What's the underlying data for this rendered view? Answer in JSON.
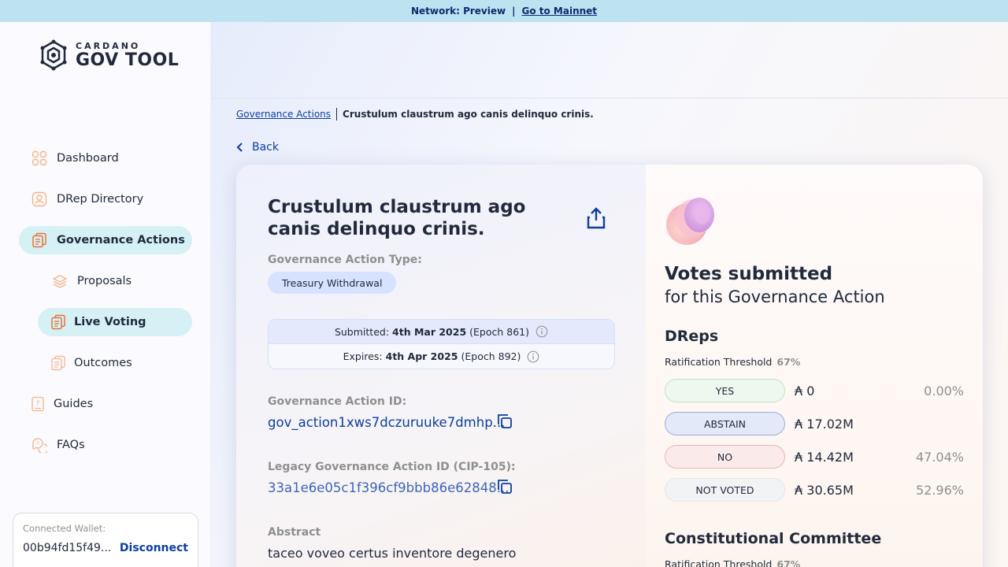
{
  "topbar": {
    "network": "Network: Preview",
    "separator": "|",
    "mainnet_link": "Go to Mainnet"
  },
  "logo": {
    "small": "CARDANO",
    "big": "GOV TOOL"
  },
  "sidebar": {
    "items": [
      {
        "label": "Dashboard",
        "icon": "dashboard-icon"
      },
      {
        "label": "DRep Directory",
        "icon": "drep-directory-icon"
      },
      {
        "label": "Governance Actions",
        "icon": "governance-actions-icon",
        "active": true
      },
      {
        "label": "Proposals",
        "icon": "proposals-icon"
      },
      {
        "label": "Live Voting",
        "icon": "live-voting-icon",
        "active": true
      },
      {
        "label": "Outcomes",
        "icon": "outcomes-icon"
      },
      {
        "label": "Guides",
        "icon": "guides-icon"
      },
      {
        "label": "FAQs",
        "icon": "faqs-icon"
      }
    ]
  },
  "wallet": {
    "label": "Connected Wallet:",
    "address": "00b94fd15f49...",
    "disconnect": "Disconnect"
  },
  "breadcrumb": {
    "parent": "Governance Actions",
    "current": "Crustulum claustrum ago canis delinquo crinis."
  },
  "back_label": "Back",
  "action": {
    "title": "Crustulum claustrum ago canis delinquo crinis.",
    "type_label": "Governance Action Type:",
    "type_value": "Treasury Withdrawal",
    "submitted_label": "Submitted:",
    "submitted_date": "4th Mar 2025",
    "submitted_epoch": "(Epoch 861)",
    "expires_label": "Expires:",
    "expires_date": "4th Apr 2025",
    "expires_epoch": "(Epoch 892)",
    "id_label": "Governance Action ID:",
    "id_value": "gov_action1xws7dczuruuke7dmhp...",
    "legacy_label": "Legacy Governance Action ID (CIP-105):",
    "legacy_value": "33a1e6e05c1f396cf9bbb86e62848...",
    "abstract_label": "Abstract",
    "abstract_text": "taceo voveo certus inventore degenero"
  },
  "votes": {
    "title": "Votes submitted",
    "subtitle": "for this Governance Action",
    "dreps_heading": "DReps",
    "threshold_label": "Ratification Threshold",
    "threshold_value": "67%",
    "rows": [
      {
        "label": "YES",
        "amount": "₳ 0",
        "percent": "0.00%",
        "bg": "#eef8ee",
        "border": "#bfe6bf"
      },
      {
        "label": "ABSTAIN",
        "amount": "₳ 17.02M",
        "percent": "",
        "bg": "#e3e9f8",
        "border": "#9aaed8"
      },
      {
        "label": "NO",
        "amount": "₳ 14.42M",
        "percent": "47.04%",
        "bg": "#fbeaea",
        "border": "#eab5b5"
      },
      {
        "label": "NOT VOTED",
        "amount": "₳ 30.65M",
        "percent": "52.96%",
        "bg": "#f2f3f5",
        "border": "#e3e5ea"
      }
    ],
    "cc_heading": "Constitutional Committee",
    "cc_threshold_label": "Ratification Threshold",
    "cc_threshold_value": "67%"
  },
  "colors": {
    "accent": "#0b3ea3",
    "active_nav": "#d5f1f6",
    "topbar": "#bde3f0"
  }
}
